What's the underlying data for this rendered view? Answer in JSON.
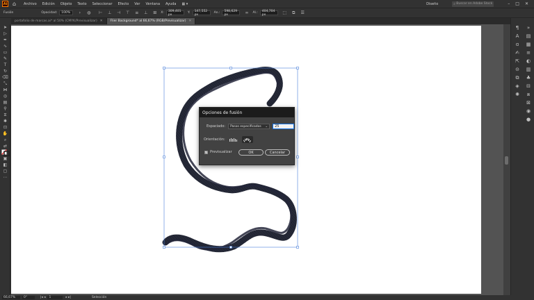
{
  "app": {
    "logo_text": "Ai",
    "menus": [
      "Archivo",
      "Edición",
      "Objeto",
      "Texto",
      "Seleccionar",
      "Efecto",
      "Ver",
      "Ventana",
      "Ayuda"
    ],
    "workspace": "Diseño",
    "search_placeholder": "Buscar en Adobe Stock"
  },
  "control_bar": {
    "selection_label": "Fusión",
    "opacity_label": "Opacidad:",
    "opacity_value": "100%",
    "x_label": "X:",
    "x_value": "309,401 px",
    "y_label": "Y:",
    "y_value": "147,552 px",
    "w_label": "An.:",
    "w_value": "598,629 px",
    "h_label": "Al.:",
    "h_value": "404,704 px"
  },
  "tabs": [
    {
      "label": "portafolio de marcas.ai* al 50% (CMYK/Previsualizar)",
      "active": false
    },
    {
      "label": "Flier Background* al 66,67% (RGB/Previsualizar)",
      "active": true
    }
  ],
  "status_bar": {
    "zoom": "66,67%",
    "rotation": "0°",
    "artboard": "1",
    "tool": "Selección"
  },
  "dialog": {
    "title": "Opciones de fusión",
    "spacing_label": "Espaciado:",
    "spacing_option": "Pasos especificados",
    "spacing_value": "25",
    "orientation_label": "Orientación:",
    "preview_label": "Previsualizar",
    "preview_checked": true,
    "ok_label": "OK",
    "cancel_label": "Cancelar"
  }
}
